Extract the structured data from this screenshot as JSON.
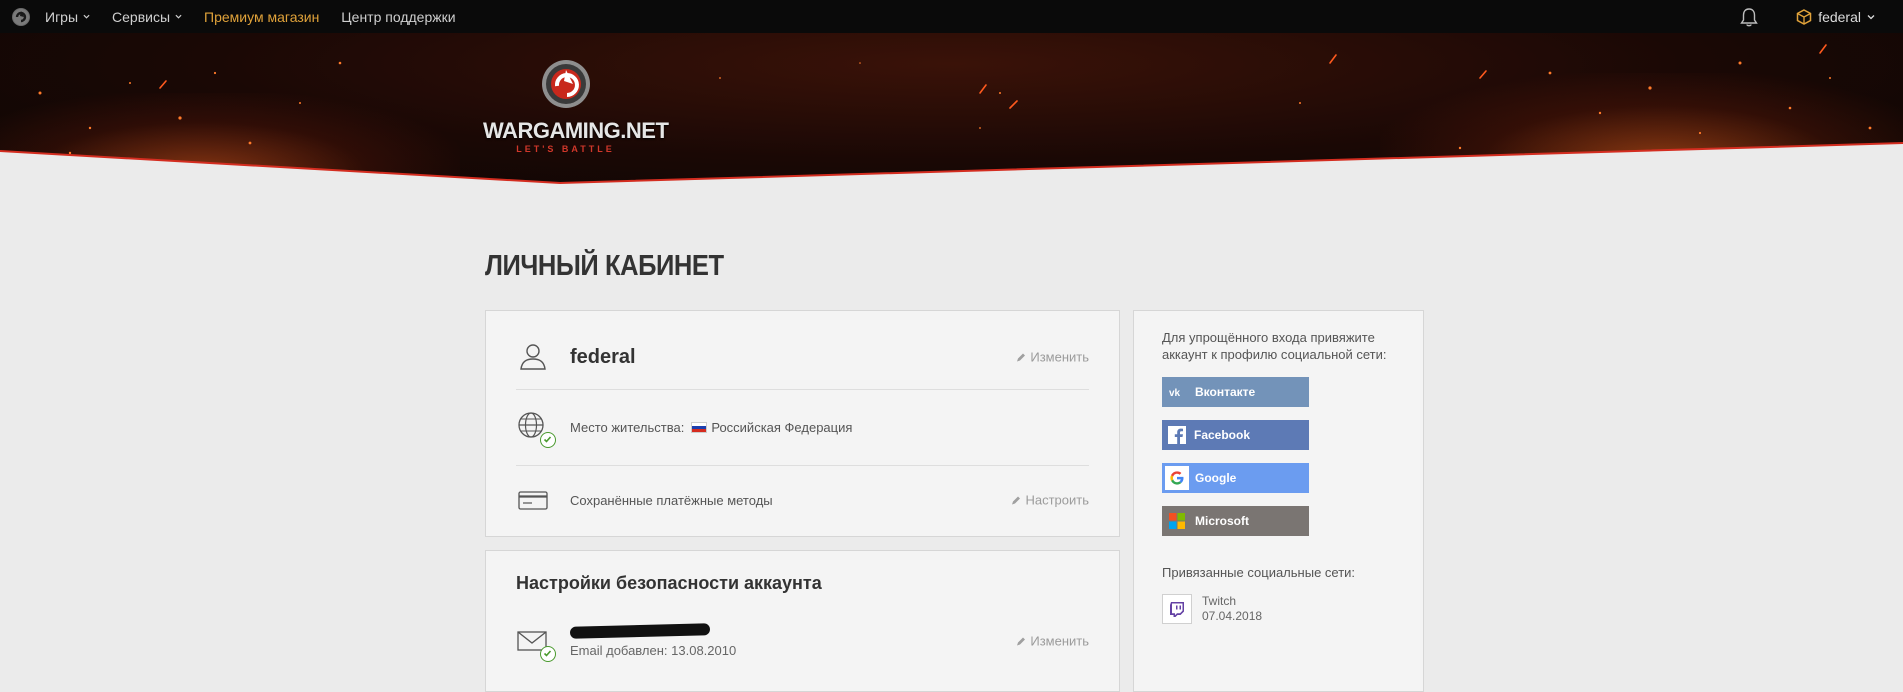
{
  "topnav": {
    "items": [
      {
        "label": "Игры",
        "has_dropdown": true
      },
      {
        "label": "Сервисы",
        "has_dropdown": true
      },
      {
        "label": "Премиум магазин",
        "has_dropdown": false
      },
      {
        "label": "Центр поддержки",
        "has_dropdown": false
      }
    ],
    "username": "federal",
    "premium_color": "#e0a23a"
  },
  "brand": {
    "wordmark": "WARGAMING.NET",
    "tagline": "LET'S BATTLE"
  },
  "page": {
    "title": "ЛИЧНЫЙ КАБИНЕТ"
  },
  "profile": {
    "username": "federal",
    "edit_label": "Изменить",
    "residence_label": "Место жительства:",
    "country": "Российская Федерация",
    "payment_label": "Сохранённые платёжные методы",
    "payment_action": "Настроить"
  },
  "security": {
    "title": "Настройки безопасности аккаунта",
    "email_added": "Email добавлен: 13.08.2010",
    "edit_label": "Изменить"
  },
  "social": {
    "intro": "Для упрощённого входа привяжите аккаунт к профилю социальной сети:",
    "buttons": {
      "vk": "Вконтакте",
      "facebook": "Facebook",
      "google": "Google",
      "microsoft": "Microsoft"
    },
    "linked_title": "Привязанные социальные сети:",
    "linked": [
      {
        "name": "Twitch",
        "date": "07.04.2018",
        "icon": "twitch-icon"
      }
    ]
  },
  "colors": {
    "accent_red": "#d0372a",
    "vk": "#7393b9",
    "facebook": "#5d7ab5",
    "google": "#6b9cf0",
    "microsoft": "#7a7572",
    "success": "#4a9a2e"
  }
}
